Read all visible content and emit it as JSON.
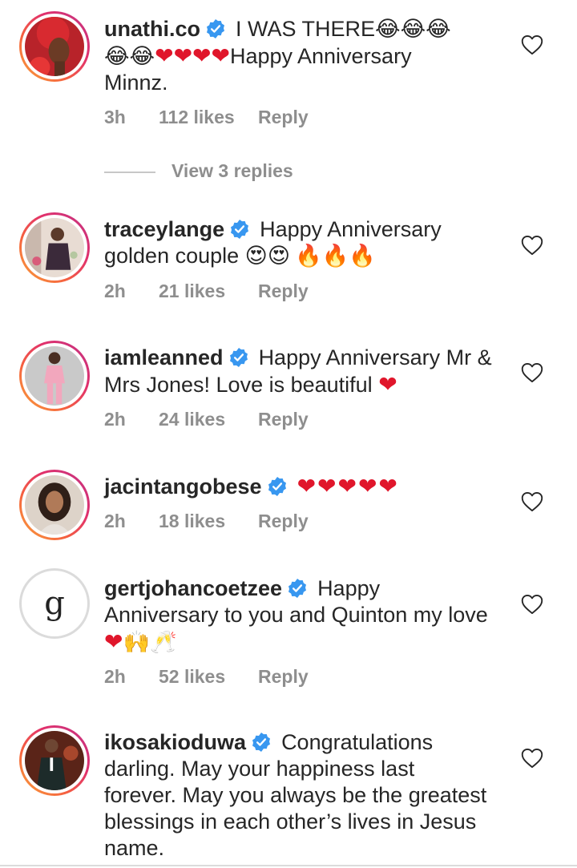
{
  "comments": [
    {
      "username": "unathi.co",
      "text": "I WAS THERE😂😂😂😂😂❤❤❤❤Happy Anniversary Minnz.",
      "text_parts": [
        "I WAS THERE",
        "😂😂😂",
        "😂😂",
        "❤❤❤❤",
        "Happy Anniversary",
        "Minnz."
      ],
      "time": "3h",
      "likes": "112 likes",
      "reply": "Reply",
      "avatar_icon": "woman-red-headwrap-avatar",
      "view_replies": "View 3 replies"
    },
    {
      "username": "traceylange",
      "text": "Happy Anniversary golden couple 😍😍🔥🔥🔥",
      "text_parts": [
        "Happy Anniversary",
        "golden couple",
        "😍😍",
        "🔥🔥🔥"
      ],
      "time": "2h",
      "likes": "21 likes",
      "reply": "Reply",
      "avatar_icon": "woman-seated-avatar"
    },
    {
      "username": "iamleanned",
      "text": "Happy Anniversary Mr & Mrs Jones! Love is beautiful ❤",
      "text_parts": [
        "Happy Anniversary Mr &",
        "Mrs Jones! Love is beautiful",
        "❤"
      ],
      "time": "2h",
      "likes": "24 likes",
      "reply": "Reply",
      "avatar_icon": "woman-pink-suit-avatar"
    },
    {
      "username": "jacintangobese",
      "text": "❤❤❤❤❤",
      "text_parts": [
        "❤❤❤❤❤"
      ],
      "time": "2h",
      "likes": "18 likes",
      "reply": "Reply",
      "avatar_icon": "woman-portrait-avatar"
    },
    {
      "username": "gertjohancoetzee",
      "text": "Happy Anniversary to you and Quinton my love ❤🙌🥂",
      "text_parts": [
        "Happy",
        "Anniversary to you and Quinton my love",
        "❤",
        "🙌",
        "🥂"
      ],
      "time": "2h",
      "likes": "52 likes",
      "reply": "Reply",
      "avatar_icon": "letter-g-logo-avatar",
      "avatar_letter": "g"
    },
    {
      "username": "ikosakioduwa",
      "text": "Congratulations darling. May your happiness last forever. May you always be the greatest blessings in each other’s lives in Jesus name.",
      "text_parts": [
        "Congratulations",
        "darling. May your happiness last",
        "forever. May you always be the greatest",
        "blessings in each other’s lives in Jesus",
        "name."
      ],
      "avatar_icon": "man-suit-avatar"
    }
  ],
  "colors": {
    "text": "#262626",
    "meta": "#8e8e8e",
    "verified": "#3897f0",
    "heart_emoji": "#e0162b",
    "ring_start": "#f9a43a",
    "ring_end": "#c13584"
  },
  "icons": {
    "verified": "verified-badge-icon",
    "like": "heart-outline-icon"
  }
}
